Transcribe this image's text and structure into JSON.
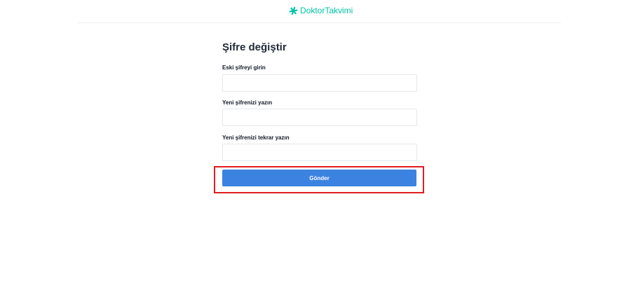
{
  "header": {
    "brand": "DoktorTakvimi",
    "brand_color": "#00c3a5",
    "logo_icon": "asterisk-logo-icon"
  },
  "form": {
    "title": "Şifre değiştir",
    "fields": [
      {
        "label": "Eski şifreyi girin",
        "value": ""
      },
      {
        "label": "Yeni şifrenizi yazın",
        "value": ""
      },
      {
        "label": "Yeni şifrenizi tekrar yazın",
        "value": ""
      }
    ],
    "submit_label": "Gönder",
    "submit_color": "#3c82e0"
  },
  "annotation": {
    "highlight_color": "#e11d1d"
  }
}
